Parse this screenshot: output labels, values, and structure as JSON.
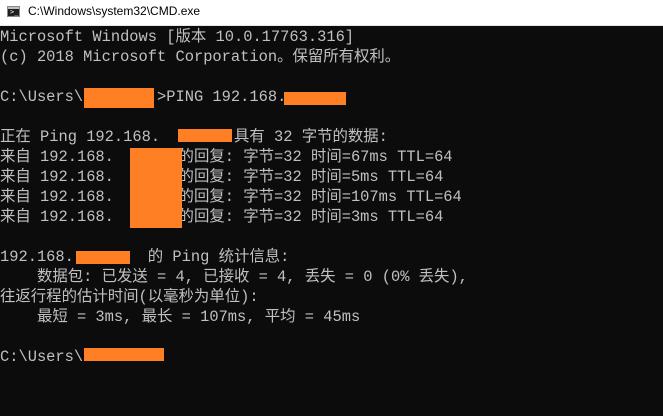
{
  "window": {
    "title": "C:\\Windows\\system32\\CMD.exe",
    "icon_name": "cmd-icon",
    "icon_glyph": ">_"
  },
  "console": {
    "lines": [
      "Microsoft Windows [版本 10.0.17763.316]",
      "(c) 2018 Microsoft Corporation。保留所有权利。",
      "C:\\Users\\        >PING 192.168.",
      "正在 Ping 192.168.        具有 32 字节的数据:",
      "来自 192.168.       的回复: 字节=32 时间=67ms TTL=64",
      "来自 192.168.       的回复: 字节=32 时间=5ms TTL=64",
      "来自 192.168.       的回复: 字节=32 时间=107ms TTL=64",
      "来自 192.168.       的回复: 字节=32 时间=3ms TTL=64",
      "192.168.        的 Ping 统计信息:",
      "    数据包: 已发送 = 4, 已接收 = 4, 丢失 = 0 (0% 丢失),",
      "往返行程的估计时间(以毫秒为单位):",
      "    最短 = 3ms, 最长 = 107ms, 平均 = 45ms",
      "C:\\Users\\"
    ]
  },
  "colors": {
    "background": "#0c0c0c",
    "text": "#c0c0c0",
    "redaction": "#ff7f24"
  }
}
